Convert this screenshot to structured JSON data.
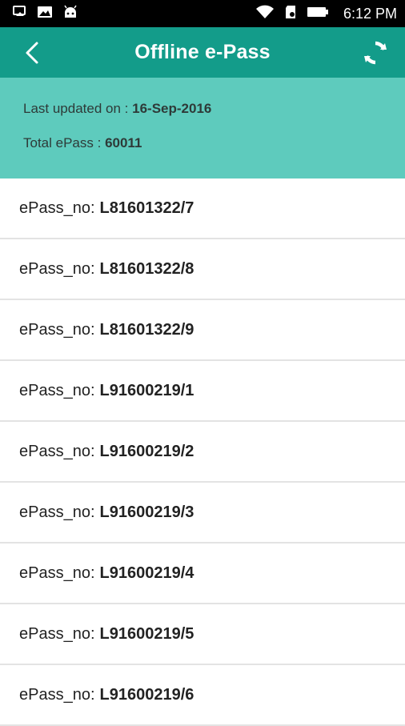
{
  "status_bar": {
    "time": "6:12 PM",
    "icons_left": [
      "screen-cast-icon",
      "image-icon",
      "android-icon"
    ],
    "icons_right": [
      "wifi-icon",
      "sd-card-icon",
      "battery-icon"
    ]
  },
  "header": {
    "title": "Offline e-Pass",
    "back_icon": "chevron-left-icon",
    "refresh_icon": "refresh-icon",
    "background": "#139c8a"
  },
  "info": {
    "last_updated_label": "Last updated on :",
    "last_updated_value": "16-Sep-2016",
    "total_label": "Total ePass :",
    "total_value": "60011",
    "background": "#5ecbbd"
  },
  "passes": {
    "label": "ePass_no:",
    "items": [
      "L81601322/7",
      "L81601322/8",
      "L81601322/9",
      "L91600219/1",
      "L91600219/2",
      "L91600219/3",
      "L91600219/4",
      "L91600219/5",
      "L91600219/6"
    ]
  }
}
